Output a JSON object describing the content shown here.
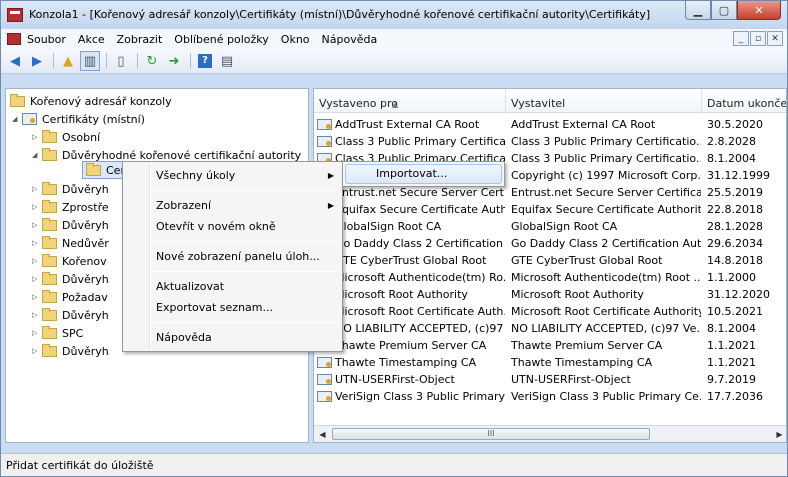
{
  "window": {
    "title": "Konzola1 - [Kořenový adresář konzoly\\Certifikáty (místní)\\Důvěryhodné kořenové certifikační autority\\Certifikáty]"
  },
  "menubar": {
    "items": [
      "Soubor",
      "Akce",
      "Zobrazit",
      "Oblíbené položky",
      "Okno",
      "Nápověda"
    ]
  },
  "tree": {
    "root": "Kořenový adresář konzoly",
    "store": "Certifikáty (místní)",
    "items": [
      "Osobní",
      "Důvěryhodné kořenové certifikační autority",
      "Certifikáty",
      "Důvěryh",
      "Zprostře",
      "Důvěryh",
      "Nedůvěr",
      "Kořenov",
      "Důvěryh",
      "Požadav",
      "Důvěryh",
      "SPC",
      "Důvěryh"
    ]
  },
  "list": {
    "columns": [
      "Vystaveno pro",
      "Vystavitel",
      "Datum ukonče..."
    ],
    "rows": [
      {
        "issued_to": "AddTrust External CA Root",
        "issuer": "AddTrust External CA Root",
        "date": "30.5.2020"
      },
      {
        "issued_to": "Class 3 Public Primary Certificat...",
        "issuer": "Class 3 Public Primary Certificatio...",
        "date": "2.8.2028"
      },
      {
        "issued_to": "Class 3 Public Primary Certificat...",
        "issuer": "Class 3 Public Primary Certificatio...",
        "date": "8.1.2004"
      },
      {
        "issued_to": "Copyright (c) 1997 Microsoft Corp.",
        "issuer": "Copyright (c) 1997 Microsoft Corp.",
        "date": "31.12.1999"
      },
      {
        "issued_to": "Entrust.net Secure Server Certifi...",
        "issuer": "Entrust.net Secure Server Certificat...",
        "date": "25.5.2019"
      },
      {
        "issued_to": "Equifax Secure Certificate Auth...",
        "issuer": "Equifax Secure Certificate Authority",
        "date": "22.8.2018"
      },
      {
        "issued_to": "GlobalSign Root CA",
        "issuer": "GlobalSign Root CA",
        "date": "28.1.2028"
      },
      {
        "issued_to": "Go Daddy Class 2 Certification ...",
        "issuer": "Go Daddy Class 2 Certification Aut...",
        "date": "29.6.2034"
      },
      {
        "issued_to": "GTE CyberTrust Global Root",
        "issuer": "GTE CyberTrust Global Root",
        "date": "14.8.2018"
      },
      {
        "issued_to": "Microsoft Authenticode(tm) Ro...",
        "issuer": "Microsoft Authenticode(tm) Root ...",
        "date": "1.1.2000"
      },
      {
        "issued_to": "Microsoft Root Authority",
        "issuer": "Microsoft Root Authority",
        "date": "31.12.2020"
      },
      {
        "issued_to": "Microsoft Root Certificate Auth...",
        "issuer": "Microsoft Root Certificate Authority",
        "date": "10.5.2021"
      },
      {
        "issued_to": "NO LIABILITY ACCEPTED, (c)97 ...",
        "issuer": "NO LIABILITY ACCEPTED, (c)97 Ve...",
        "date": "8.1.2004"
      },
      {
        "issued_to": "Thawte Premium Server CA",
        "issuer": "Thawte Premium Server CA",
        "date": "1.1.2021"
      },
      {
        "issued_to": "Thawte Timestamping CA",
        "issuer": "Thawte Timestamping CA",
        "date": "1.1.2021"
      },
      {
        "issued_to": "UTN-USERFirst-Object",
        "issuer": "UTN-USERFirst-Object",
        "date": "9.7.2019"
      },
      {
        "issued_to": "VeriSign Class 3 Public Primary ...",
        "issuer": "VeriSign Class 3 Public Primary Ce...",
        "date": "17.7.2036"
      }
    ],
    "scroll_thumb_label": "III"
  },
  "context_menu": {
    "all_tasks": "Všechny úkoly",
    "view": "Zobrazení",
    "open_new_window": "Otevřít v novém okně",
    "new_taskpad": "Nové zobrazení panelu úloh...",
    "refresh": "Aktualizovat",
    "export_list": "Exportovat seznam...",
    "help": "Nápověda"
  },
  "submenu": {
    "import": "Importovat..."
  },
  "status": {
    "text": "Přidat certifikát do úložiště"
  }
}
